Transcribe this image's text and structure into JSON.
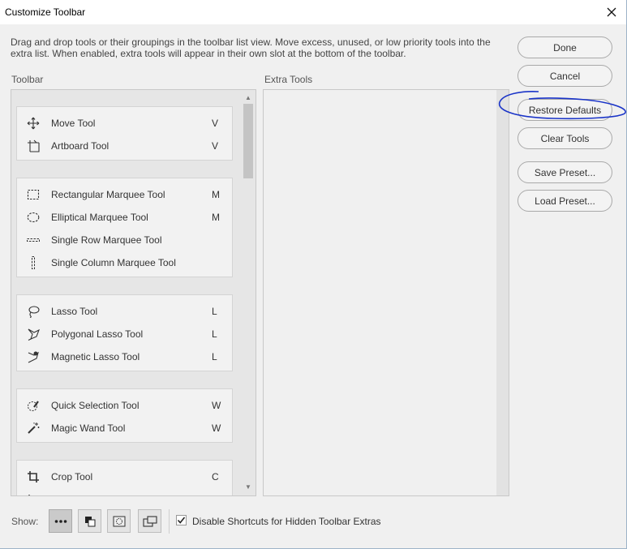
{
  "window": {
    "title": "Customize Toolbar"
  },
  "description": "Drag and drop tools or their groupings in the toolbar list view. Move excess, unused, or low priority tools into the extra list. When enabled, extra tools will appear in their own slot at the bottom of the toolbar.",
  "toolbar_label": "Toolbar",
  "extra_label": "Extra Tools",
  "tool_groups": [
    {
      "tools": [
        {
          "label": "Move Tool",
          "key": "V",
          "icon": "move-icon"
        },
        {
          "label": "Artboard Tool",
          "key": "V",
          "icon": "artboard-icon"
        }
      ]
    },
    {
      "tools": [
        {
          "label": "Rectangular Marquee Tool",
          "key": "M",
          "icon": "rect-marquee-icon"
        },
        {
          "label": "Elliptical Marquee Tool",
          "key": "M",
          "icon": "ellipse-marquee-icon"
        },
        {
          "label": "Single Row Marquee Tool",
          "key": "",
          "icon": "row-marquee-icon"
        },
        {
          "label": "Single Column Marquee Tool",
          "key": "",
          "icon": "column-marquee-icon"
        }
      ]
    },
    {
      "tools": [
        {
          "label": "Lasso Tool",
          "key": "L",
          "icon": "lasso-icon"
        },
        {
          "label": "Polygonal Lasso Tool",
          "key": "L",
          "icon": "polygonal-lasso-icon"
        },
        {
          "label": "Magnetic Lasso Tool",
          "key": "L",
          "icon": "magnetic-lasso-icon"
        }
      ]
    },
    {
      "tools": [
        {
          "label": "Quick Selection Tool",
          "key": "W",
          "icon": "quick-selection-icon"
        },
        {
          "label": "Magic Wand Tool",
          "key": "W",
          "icon": "magic-wand-icon"
        }
      ]
    },
    {
      "tools": [
        {
          "label": "Crop Tool",
          "key": "C",
          "icon": "crop-icon"
        }
      ]
    }
  ],
  "buttons": {
    "done": "Done",
    "cancel": "Cancel",
    "restore": "Restore Defaults",
    "clear": "Clear Tools",
    "save_preset": "Save Preset...",
    "load_preset": "Load Preset..."
  },
  "bottom": {
    "show_label": "Show:",
    "checkbox_label": "Disable Shortcuts for Hidden Toolbar Extras",
    "checkbox_checked": true
  },
  "colors": {
    "annotation": "#1a34c8",
    "panel": "#e6e6e6",
    "group": "#f2f2f2"
  }
}
